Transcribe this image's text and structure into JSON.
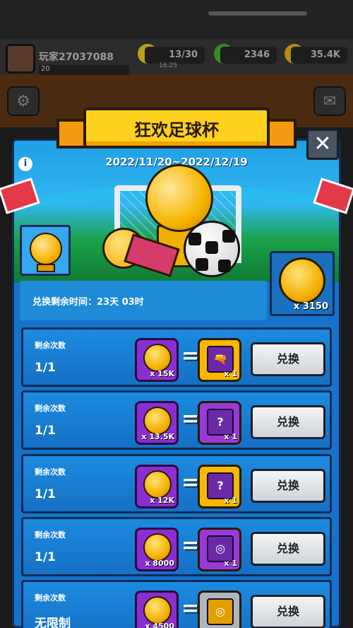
{
  "hud": {
    "player_name": "玩家27037088",
    "level": "20",
    "energy": "13/30",
    "energy_timer": "16:25",
    "gems": "2346",
    "coins": "35.4K"
  },
  "event": {
    "title": "狂欢足球杯",
    "date_range": "2022/11/20~2022/12/19",
    "info_label": "i",
    "close_label": "✕",
    "currency_count": "x 3150",
    "time_remaining": "兑换剩余时间：23天 03时"
  },
  "rows": [
    {
      "label": "剩余次数",
      "count": "1/1",
      "cost": "x 15K",
      "reward_qty": "x 1",
      "reward_symbol": "🔫",
      "reward_style": "gold",
      "button": "兑换"
    },
    {
      "label": "剩余次数",
      "count": "1/1",
      "cost": "x 13.5K",
      "reward_qty": "x 1",
      "reward_symbol": "?",
      "reward_style": "purple",
      "button": "兑换"
    },
    {
      "label": "剩余次数",
      "count": "1/1",
      "cost": "x 12K",
      "reward_qty": "x 1",
      "reward_symbol": "?",
      "reward_style": "gold",
      "button": "兑换"
    },
    {
      "label": "剩余次数",
      "count": "1/1",
      "cost": "x 8000",
      "reward_qty": "x 1",
      "reward_symbol": "◎",
      "reward_style": "purple",
      "button": "兑换"
    },
    {
      "label": "剩余次数",
      "count": "无限制",
      "cost": "x 4500",
      "reward_qty": "",
      "reward_symbol": "◎",
      "reward_style": "silver",
      "button": "兑换"
    }
  ],
  "colors": {
    "panel_blue": "#1673c9",
    "title_yellow": "#ffd21f",
    "coin_gold": "#f3b000",
    "tile_purple": "#8a2ed0"
  }
}
